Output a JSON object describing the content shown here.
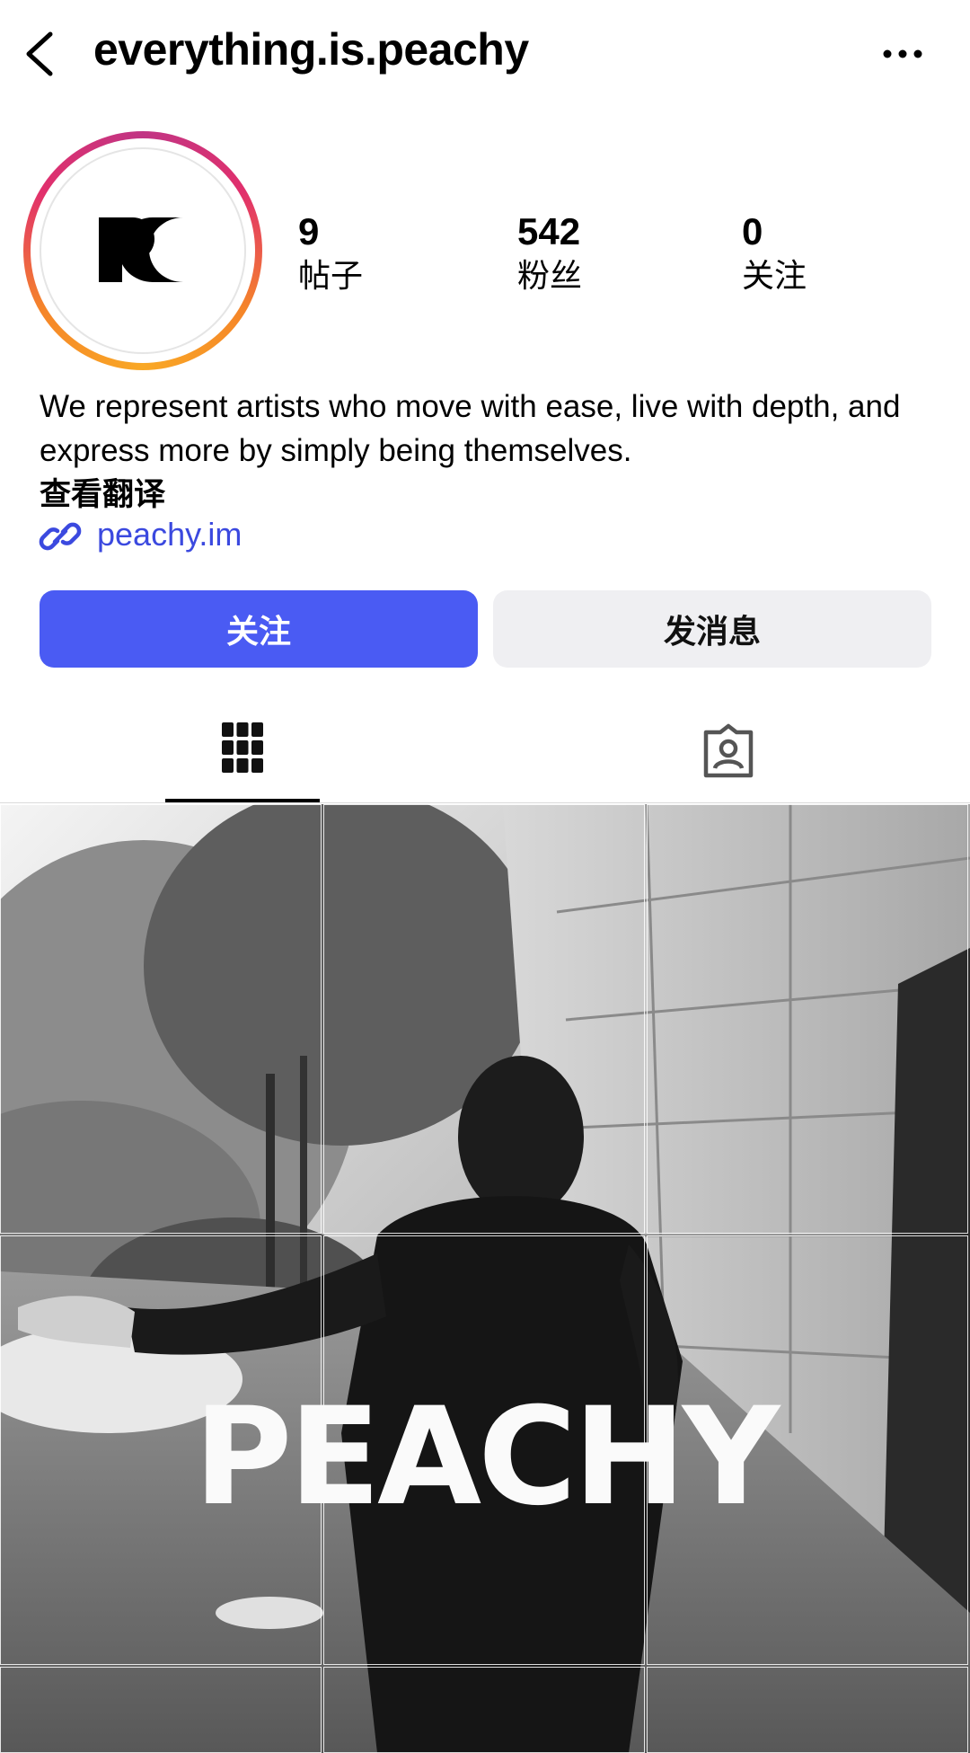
{
  "header": {
    "title": "everything.is.peachy",
    "back_icon": "chevron-left-icon",
    "more_icon": "ellipsis-icon"
  },
  "profile": {
    "avatar_logo": "PC",
    "stats": [
      {
        "value": "9",
        "label": "帖子"
      },
      {
        "value": "542",
        "label": "粉丝"
      },
      {
        "value": "0",
        "label": "关注"
      }
    ],
    "bio": "We represent artists who move with ease, live with depth, and express more by simply being themselves.",
    "translate_label": "查看翻译",
    "link_text": "peachy.im"
  },
  "actions": {
    "follow_label": "关注",
    "message_label": "发消息"
  },
  "tabs": [
    {
      "icon": "grid-icon",
      "active": true
    },
    {
      "icon": "tagged-person-icon",
      "active": false
    }
  ],
  "grid": {
    "overlay_text": "PEACHY"
  },
  "colors": {
    "follow_button": "#4a5bf3",
    "message_button": "#efeff2",
    "link": "#3b49df"
  }
}
